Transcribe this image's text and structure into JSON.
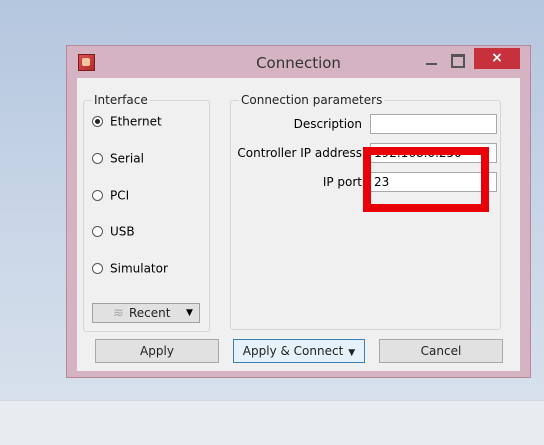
{
  "window": {
    "title": "Connection",
    "close_glyph": "×",
    "app_icon": "app-icon",
    "minimize_icon": "minimize-icon",
    "maximize_icon": "maximize-icon"
  },
  "interface": {
    "legend": "Interface",
    "options": [
      {
        "label": "Ethernet",
        "selected": true
      },
      {
        "label": "Serial",
        "selected": false
      },
      {
        "label": "PCI",
        "selected": false
      },
      {
        "label": "USB",
        "selected": false
      },
      {
        "label": "Simulator",
        "selected": false
      }
    ],
    "recent_label": "Recent",
    "recent_icon_glyph": "≋"
  },
  "params": {
    "legend": "Connection parameters",
    "description_label": "Description",
    "description_value": "",
    "ip_label": "Controller IP address",
    "ip_value": "192.168.0.250",
    "port_label": "IP port",
    "port_value": "23"
  },
  "footer": {
    "apply_label": "Apply",
    "apply_connect_label": "Apply & Connect",
    "dropdown_glyph": "▼",
    "cancel_label": "Cancel"
  },
  "colors": {
    "highlight": "#ea0008",
    "close_button": "#c7313c",
    "window_frame": "#d6b3c2"
  }
}
